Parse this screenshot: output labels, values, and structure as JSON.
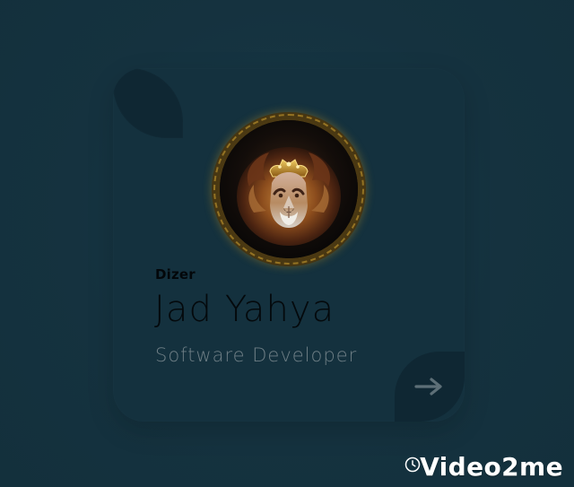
{
  "profile": {
    "tag": "Dizer",
    "name": "Jad Yahya",
    "role": "Software Developer"
  },
  "icons": {
    "avatar": "lion-with-crown",
    "nav": "arrow-right-icon",
    "watermark": "clock-icon"
  },
  "watermark": {
    "text": "Video2me"
  },
  "colors": {
    "background": "#15323f",
    "card": "#14313e",
    "leaf": "#0f2733",
    "accent": "#d3a431"
  }
}
